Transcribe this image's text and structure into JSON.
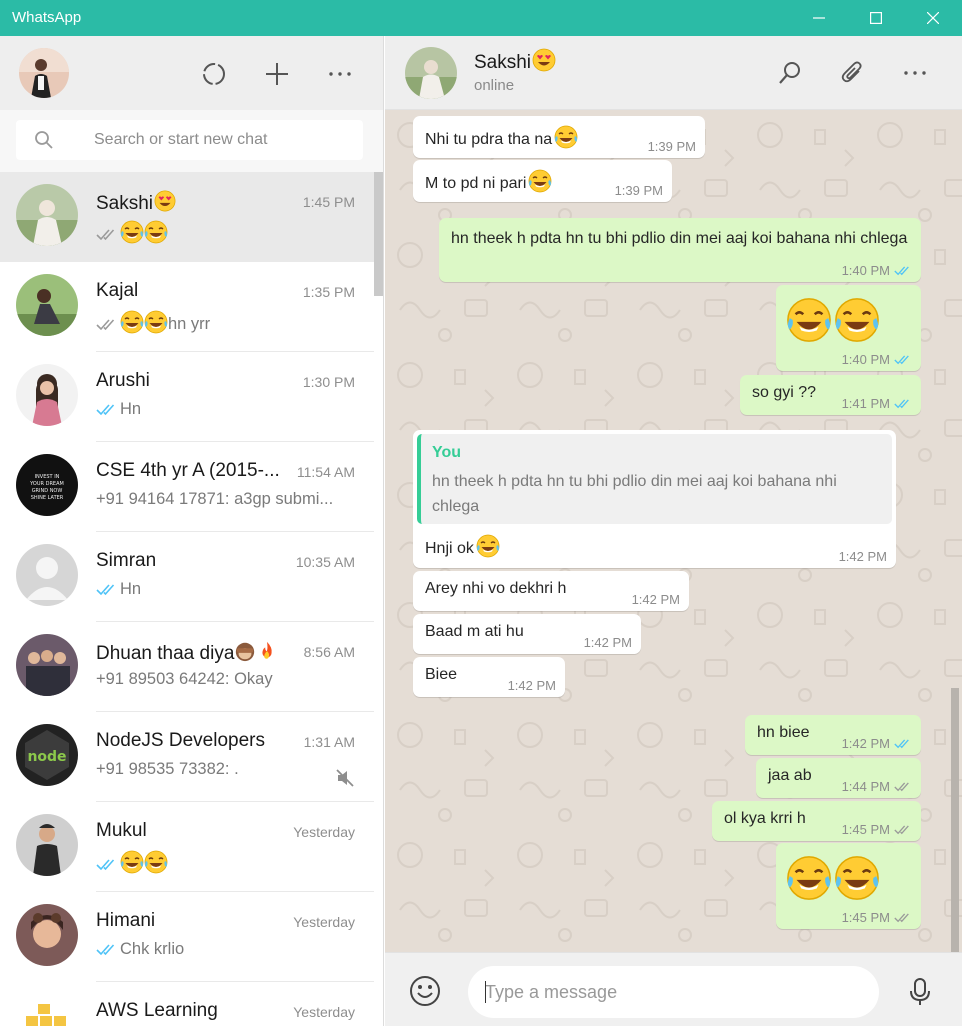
{
  "window": {
    "title": "WhatsApp"
  },
  "left_header": {
    "icons": [
      "status-icon",
      "new-chat-icon",
      "menu-icon"
    ]
  },
  "search": {
    "placeholder": "Search or start new chat"
  },
  "chats": [
    {
      "name": "Sakshi",
      "time": "1:45 PM",
      "last": "",
      "tick": "grey",
      "emojis": 2,
      "name_emoji": "heart-eyes"
    },
    {
      "name": "Kajal",
      "time": "1:35 PM",
      "last": "hn yrr",
      "tick": "grey",
      "emojis": 2
    },
    {
      "name": "Arushi",
      "time": "1:30 PM",
      "last": "Hn",
      "tick": "blue",
      "emojis": 0
    },
    {
      "name": "CSE 4th yr A (2015-...",
      "time": "11:54 AM",
      "last": "+91 94164 17871: a3gp submi...",
      "tick": "none",
      "emojis": 0
    },
    {
      "name": "Simran",
      "time": "10:35 AM",
      "last": "Hn",
      "tick": "blue",
      "emojis": 0
    },
    {
      "name": "Dhuan thaa diya",
      "time": "8:56 AM",
      "last": "+91 89503 64242: Okay",
      "tick": "none",
      "emojis": 0,
      "name_emoji": "monkey-fire"
    },
    {
      "name": "NodeJS Developers",
      "time": "1:31 AM",
      "last": "+91 98535 73382: .",
      "tick": "none",
      "emojis": 0,
      "muted": true
    },
    {
      "name": "Mukul",
      "time": "Yesterday",
      "last": "",
      "tick": "blue",
      "emojis": 2
    },
    {
      "name": "Himani",
      "time": "Yesterday",
      "last": "Chk krlio",
      "tick": "blue",
      "emojis": 0
    },
    {
      "name": "AWS Learning",
      "time": "Yesterday",
      "last": "",
      "tick": "none",
      "emojis": 0
    }
  ],
  "avatar_colors": [
    "#b9c9a8",
    "#9bbf7a",
    "#d77a92",
    "#111111",
    "#d6d6d6",
    "#6b5a6a",
    "#222222",
    "#cfcfcf",
    "#7d5a58",
    "#f4c542"
  ],
  "avatar_texts": {
    "cse": "INVEST IN YOUR DREAM GRIND NOW SHINE LATER",
    "node": "node"
  },
  "conversation": {
    "contact_name": "Sakshi",
    "status": "online",
    "icons": [
      "search-icon",
      "attach-icon",
      "menu-icon"
    ],
    "messages": [
      {
        "dir": "in",
        "text": "Nhi tu pdra tha na",
        "time": "1:39 PM",
        "emoji_after": 1
      },
      {
        "dir": "in",
        "text": "M to pd ni pari",
        "time": "1:39 PM",
        "emoji_after": 1
      },
      {
        "dir": "out",
        "text": "hn theek h pdta hn tu bhi pdlio din mei aaj koi bahana nhi chlega",
        "time": "1:40 PM",
        "tick": "blue"
      },
      {
        "dir": "out",
        "text": "",
        "time": "1:40 PM",
        "tick": "blue",
        "big_emojis": 2
      },
      {
        "dir": "out",
        "text": "so gyi ??",
        "time": "1:41 PM",
        "tick": "blue"
      },
      {
        "dir": "in",
        "quote_author": "You",
        "quote_text": "hn theek h pdta hn tu bhi pdlio din mei aaj koi bahana nhi chlega",
        "text": "Hnji ok",
        "time": "1:42 PM",
        "emoji_after": 1
      },
      {
        "dir": "in",
        "text": "Arey nhi vo dekhri h",
        "time": "1:42 PM"
      },
      {
        "dir": "in",
        "text": "Baad m ati hu",
        "time": "1:42 PM"
      },
      {
        "dir": "in",
        "text": "Biee",
        "time": "1:42 PM"
      },
      {
        "dir": "out",
        "text": "hn biee",
        "time": "1:42 PM",
        "tick": "blue"
      },
      {
        "dir": "out",
        "text": "jaa ab",
        "time": "1:44 PM",
        "tick": "grey"
      },
      {
        "dir": "out",
        "text": "ol kya krri h",
        "time": "1:45 PM",
        "tick": "grey"
      },
      {
        "dir": "out",
        "text": "",
        "time": "1:45 PM",
        "tick": "grey",
        "big_emojis": 2
      }
    ]
  },
  "composer": {
    "placeholder": "Type a message",
    "value": ""
  },
  "colors": {
    "brand": "#2bbba6",
    "tick_blue": "#4fc3f7",
    "tick_grey": "#9a9a9a",
    "out_bubble": "#dcf8c6",
    "in_bubble": "#ffffff",
    "chat_bg": "#e5ddd5",
    "quote_accent": "#35cd96"
  }
}
